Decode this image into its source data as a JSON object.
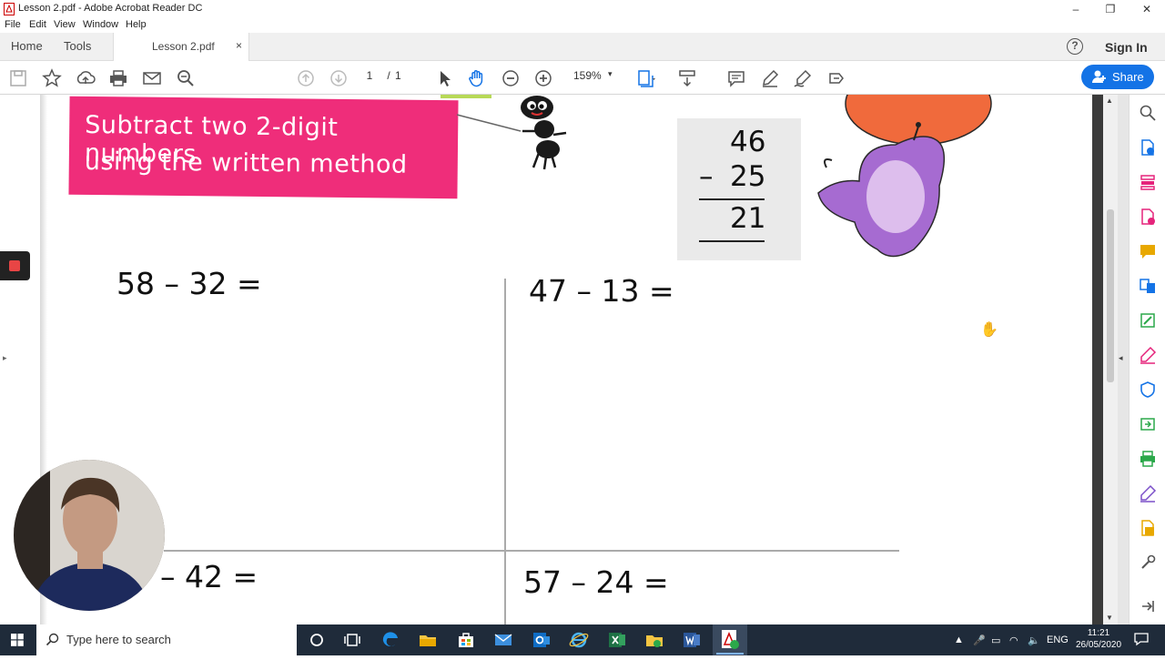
{
  "window": {
    "title": "Lesson 2.pdf - Adobe Acrobat Reader DC",
    "controls": [
      "–",
      "❐",
      "✕"
    ]
  },
  "menu": [
    "File",
    "Edit",
    "View",
    "Window",
    "Help"
  ],
  "tabs": {
    "home": "Home",
    "tools": "Tools",
    "document": "Lesson 2.pdf",
    "close": "×",
    "help": "?",
    "sign_in": "Sign In"
  },
  "toolbar": {
    "current_page": "1",
    "page_separator": "/",
    "total_pages": "1",
    "zoom": "159%",
    "share_label": "Share",
    "icons": [
      "save-icon",
      "bookmark-star-icon",
      "upload-icon",
      "print-icon",
      "email-icon",
      "find-icon",
      "page-up-icon",
      "page-down-icon",
      "select-arrow-icon",
      "hand-icon",
      "zoom-out-icon",
      "zoom-in-icon",
      "fit-page-icon",
      "scroll-mode-icon",
      "comment-icon",
      "highlight-icon",
      "sign-icon",
      "more-tools-icon"
    ]
  },
  "document": {
    "banner_line1": "Subtract two 2-digit numbers",
    "banner_line2": "using the written method",
    "example": {
      "top": "46",
      "minus_sign": "–",
      "bottom": "25",
      "result": "21"
    },
    "problems": [
      "58 – 32 =",
      "47 – 13 =",
      "– 42 =",
      "57 – 24 ="
    ]
  },
  "right_panel_icons": [
    "search-tools-icon",
    "create-pdf-icon",
    "organize-pages-icon",
    "export-pdf-icon",
    "comment-tool-icon",
    "combine-files-icon",
    "edit-pdf-icon",
    "fill-sign-icon",
    "protect-icon",
    "send-review-icon",
    "print-production-icon",
    "request-signature-icon",
    "scan-icon",
    "more-tools-icon",
    "collapse-panel-icon"
  ],
  "taskbar": {
    "search_placeholder": "Type here to search",
    "language": "ENG",
    "time": "11:21",
    "date": "26/05/2020"
  },
  "colors": {
    "banner": "#ef2d7a",
    "share_button": "#1473e6",
    "taskbar": "#1f2b3a",
    "right_panel_accent_blue": "#1473e6",
    "right_panel_accent_pink": "#e5247b",
    "right_panel_accent_green": "#2ba84a",
    "right_panel_accent_yellow": "#e8a800"
  }
}
